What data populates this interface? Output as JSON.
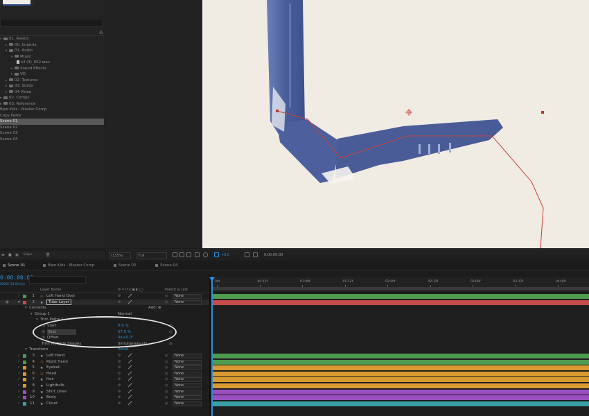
{
  "project": {
    "tree": [
      {
        "label": "01. Assets",
        "depth": 0,
        "type": "folder",
        "expanded": true
      },
      {
        "label": "00. Imports",
        "depth": 1,
        "type": "folder"
      },
      {
        "label": "01. Audio",
        "depth": 1,
        "type": "folder",
        "expanded": true
      },
      {
        "label": "Music",
        "depth": 2,
        "type": "folder",
        "expanded": true
      },
      {
        "label": "s4 (3)_052.wav",
        "depth": 3,
        "type": "audio"
      },
      {
        "label": "Sound Effects",
        "depth": 2,
        "type": "folder"
      },
      {
        "label": "VO",
        "depth": 2,
        "type": "folder"
      },
      {
        "label": "02. Textures",
        "depth": 1,
        "type": "folder"
      },
      {
        "label": "03. Solids",
        "depth": 1,
        "type": "folder"
      },
      {
        "label": "04 Video",
        "depth": 1,
        "type": "folder"
      },
      {
        "label": "02. Comps",
        "depth": 0,
        "type": "folder"
      },
      {
        "label": "03. Reference",
        "depth": 0,
        "type": "folder"
      },
      {
        "label": "Bipo Kids - Master Comp",
        "depth": 0,
        "type": "comp"
      },
      {
        "label": "Copy Paste",
        "depth": 0,
        "type": "comp"
      },
      {
        "label": "Scene 01",
        "depth": 0,
        "type": "comp",
        "selected": true
      },
      {
        "label": "Scene 02",
        "depth": 0,
        "type": "comp"
      },
      {
        "label": "Scene 03",
        "depth": 0,
        "type": "comp"
      },
      {
        "label": "Scene 04",
        "depth": 0,
        "type": "comp"
      }
    ],
    "footer_bpc": "8 bpc"
  },
  "viewer_bar": {
    "zoom": "(135%)",
    "resolution": "Full",
    "exposure": "+0.0",
    "timecode": "0:00:00:00"
  },
  "tabs": [
    {
      "label": "Scene 01",
      "active": true,
      "color": "#6e6e6e"
    },
    {
      "label": "Bipo Kids - Master Comp",
      "active": false,
      "color": "#6e6e6e"
    },
    {
      "label": "Scene 02",
      "active": false,
      "color": "#6e6e6e"
    },
    {
      "label": "Scene 04",
      "active": false,
      "color": "#6e6e6e"
    }
  ],
  "timeline": {
    "current_time": "0:00:00:00",
    "fps_info": "00000 (24.00 fps)",
    "col_layer_name": "Layer Name",
    "col_parent": "Parent & Link",
    "ruler": [
      "00f",
      "00:12f",
      "01:00f",
      "01:12f",
      "02:00f",
      "02:12f",
      "03:00f",
      "03:12f",
      "04:00f"
    ],
    "add_label": "Add:",
    "layers_top": [
      {
        "num": "1",
        "name": "Left Hand Over",
        "color": "#4e9a4e",
        "icon": "puppet",
        "parent": "None"
      },
      {
        "num": "2",
        "name": "Tube Layer",
        "color": "#c94a4a",
        "icon": "star",
        "parent": "None",
        "selected": true
      }
    ],
    "props": {
      "contents": "Contents",
      "group": "Group 1",
      "group_mode": "Normal",
      "trim": "Trim Paths 1",
      "start_label": "Start",
      "start_val": "0.0 %",
      "end_label": "End",
      "end_val": "57.0 %",
      "offset_label": "Offset",
      "offset_val": "0x+0.0°",
      "trim_multi_label": "Trim Multiple Shapes",
      "trim_multi_val": "Simultaneously",
      "transform": "Transform",
      "transform_val": "Reset"
    },
    "layers_bottom": [
      {
        "num": "3",
        "name": "Left Hand",
        "color": "#4e9a4e",
        "icon": "star",
        "parent": "None"
      },
      {
        "num": "4",
        "name": "Right Hand",
        "color": "#4e9a4e",
        "icon": "puppet",
        "parent": "None"
      },
      {
        "num": "5",
        "name": "Eyeball",
        "color": "#d89a30",
        "icon": "star",
        "parent": "None"
      },
      {
        "num": "6",
        "name": "Head",
        "color": "#d89a30",
        "icon": "puppet",
        "parent": "None"
      },
      {
        "num": "7",
        "name": "Hair",
        "color": "#d89a30",
        "icon": "star",
        "parent": "None"
      },
      {
        "num": "8",
        "name": "Lightbulb",
        "color": "#d89a30",
        "icon": "star",
        "parent": "None"
      },
      {
        "num": "9",
        "name": "Shirt Lines",
        "color": "#9a4ec0",
        "icon": "star",
        "parent": "None"
      },
      {
        "num": "10",
        "name": "Body",
        "color": "#9a4ec0",
        "icon": "star",
        "parent": "None"
      },
      {
        "num": "11",
        "name": "Cloud",
        "color": "#3aa0a8",
        "icon": "star",
        "parent": "None"
      }
    ]
  }
}
